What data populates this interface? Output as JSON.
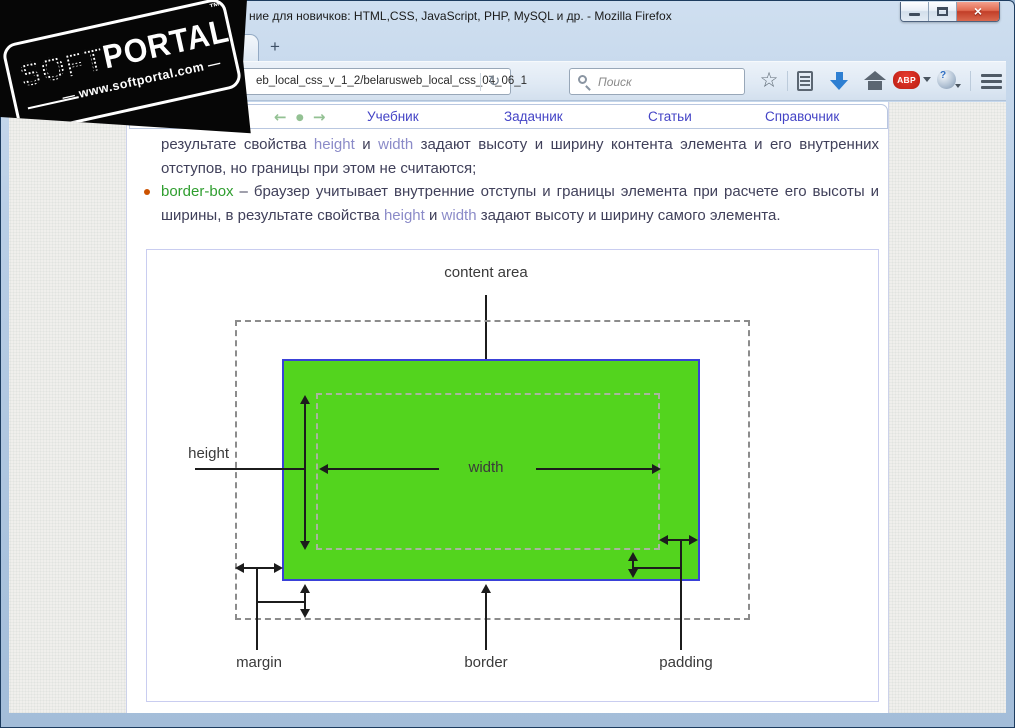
{
  "watermark": {
    "soft": "SOFT",
    "portal": "PORTAL",
    "tm": "™",
    "site": "www.softportal.com —"
  },
  "window": {
    "title": "ние для новичков: HTML,CSS, JavaScript, PHP, MySQL и др. - Mozilla Firefox"
  },
  "toolbar": {
    "new_tab": "+",
    "url": "eb_local_css_v_1_2/belarusweb_local_css_04_06_1",
    "reload_glyph": "↻",
    "search_placeholder": "Поиск",
    "star_glyph": "☆",
    "abp": "ABP",
    "nav_arrows": "← →"
  },
  "page_nav": {
    "links": [
      "Учебник",
      "Задачник",
      "Статьи",
      "Справочник"
    ]
  },
  "content": {
    "para1": [
      {
        "t": "результате свойства "
      },
      {
        "t": "height"
      },
      {
        "t": " и "
      },
      {
        "t": "width"
      },
      {
        "t": " задают высоту и ширину контента элемента и его внутренних отступов, но границы при этом не считаются;"
      }
    ],
    "item2": [
      {
        "t": "border-box"
      },
      {
        "t": " – браузер учитывает внутренние отступы и границы элемента при расчете его высоты и ширины, в результате свойства "
      },
      {
        "t": "height"
      },
      {
        "t": " и "
      },
      {
        "t": "width"
      },
      {
        "t": " задают высоту и ширину самого элемента."
      }
    ]
  },
  "diagram": {
    "labels": {
      "content_area": "content area",
      "width": "width",
      "height": "height",
      "margin": "margin",
      "border": "border",
      "padding": "padding"
    },
    "colors": {
      "element_fill": "#53d41e",
      "element_border": "#3a41d8",
      "margin_dash": "#8c8c8c",
      "content_dash": "#a9b49f",
      "arrow": "#1c1c1c"
    }
  }
}
